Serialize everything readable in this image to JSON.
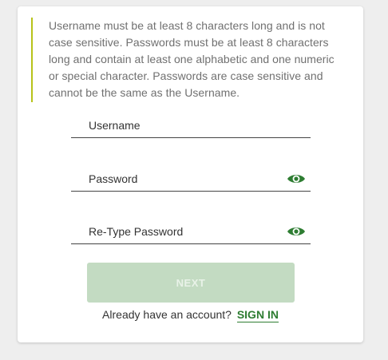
{
  "info": {
    "text": "Username must be at least 8 characters long and is not case sensitive. Passwords must be at least 8 characters long and contain at least one alphabetic and one numeric or special character. Passwords are case sensitive and cannot be the same as the Username."
  },
  "form": {
    "username_label": "Username",
    "password_label": "Password",
    "retype_label": "Re-Type Password",
    "show_password_icon": "eye-icon",
    "show_retype_icon": "eye-icon"
  },
  "next_button": {
    "label": "NEXT",
    "state": "disabled"
  },
  "signin": {
    "prompt": "Already have an account?",
    "link_label": "SIGN IN"
  },
  "colors": {
    "accent_bar": "#b7c31a",
    "brand_green": "#2e7d32",
    "disabled_button": "#c3dbc2"
  }
}
